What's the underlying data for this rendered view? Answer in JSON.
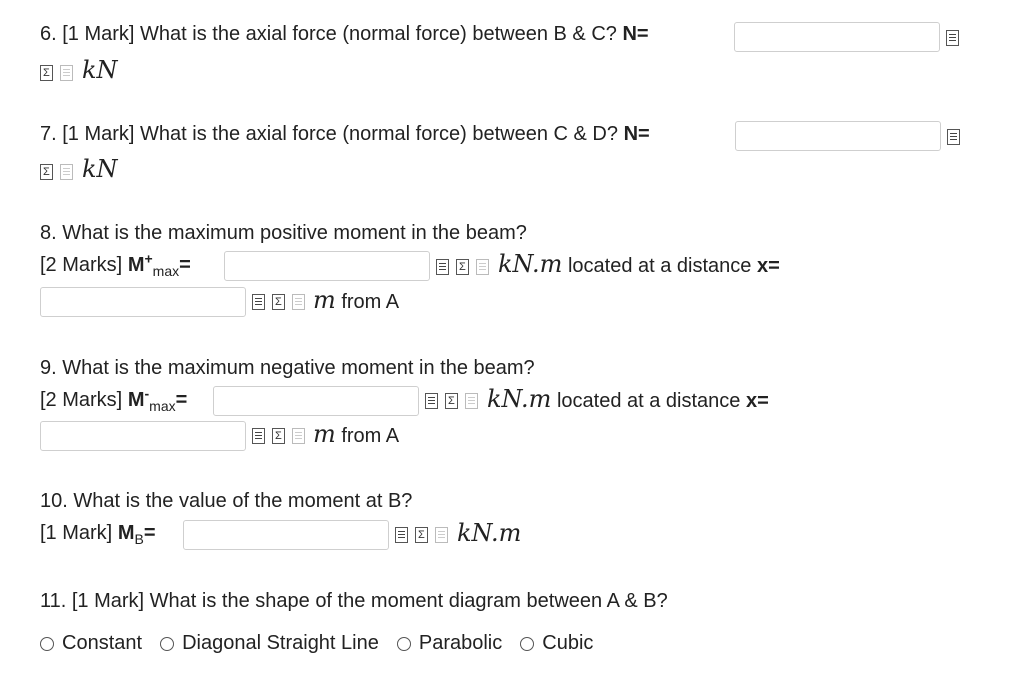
{
  "q6": {
    "text": "6. [1 Mark] What is the axial force (normal force) between B & C?",
    "var": "N=",
    "unit": "kN",
    "value": ""
  },
  "q7": {
    "text": "7. [1 Mark] What is the axial force (normal force) between C & D?",
    "var": "N=",
    "unit": "kN",
    "value": ""
  },
  "q8": {
    "text": "8. What is the maximum positive moment in the beam?",
    "marks": "[2 Marks]",
    "var_m": "M",
    "var_sup": "+",
    "var_sub": "max",
    "eq": "=",
    "unit1": "kN.m",
    "located": "located at a distance",
    "var_x": "x=",
    "unit2": "m",
    "from": "from A",
    "value1": "",
    "value2": ""
  },
  "q9": {
    "text": "9. What is the maximum negative moment in the beam?",
    "marks": "[2 Marks]",
    "var_m": "M",
    "var_sup": "-",
    "var_sub": "max",
    "eq": "=",
    "unit1": "kN.m",
    "located": "located at a distance",
    "var_x": "x=",
    "unit2": "m",
    "from": "from A",
    "value1": "",
    "value2": ""
  },
  "q10": {
    "text": "10. What is the value of the moment at B?",
    "marks": "[1 Mark]",
    "var_m": "M",
    "var_sub": "B",
    "eq": "=",
    "unit": "kN.m",
    "value": ""
  },
  "q11": {
    "text": "11. [1 Mark] What is the shape of the moment diagram between A & B?",
    "options": [
      "Constant",
      "Diagonal Straight Line",
      "Parabolic",
      "Cubic"
    ]
  },
  "icons": [
    "preview-icon",
    "equation-icon",
    "notes-icon"
  ]
}
